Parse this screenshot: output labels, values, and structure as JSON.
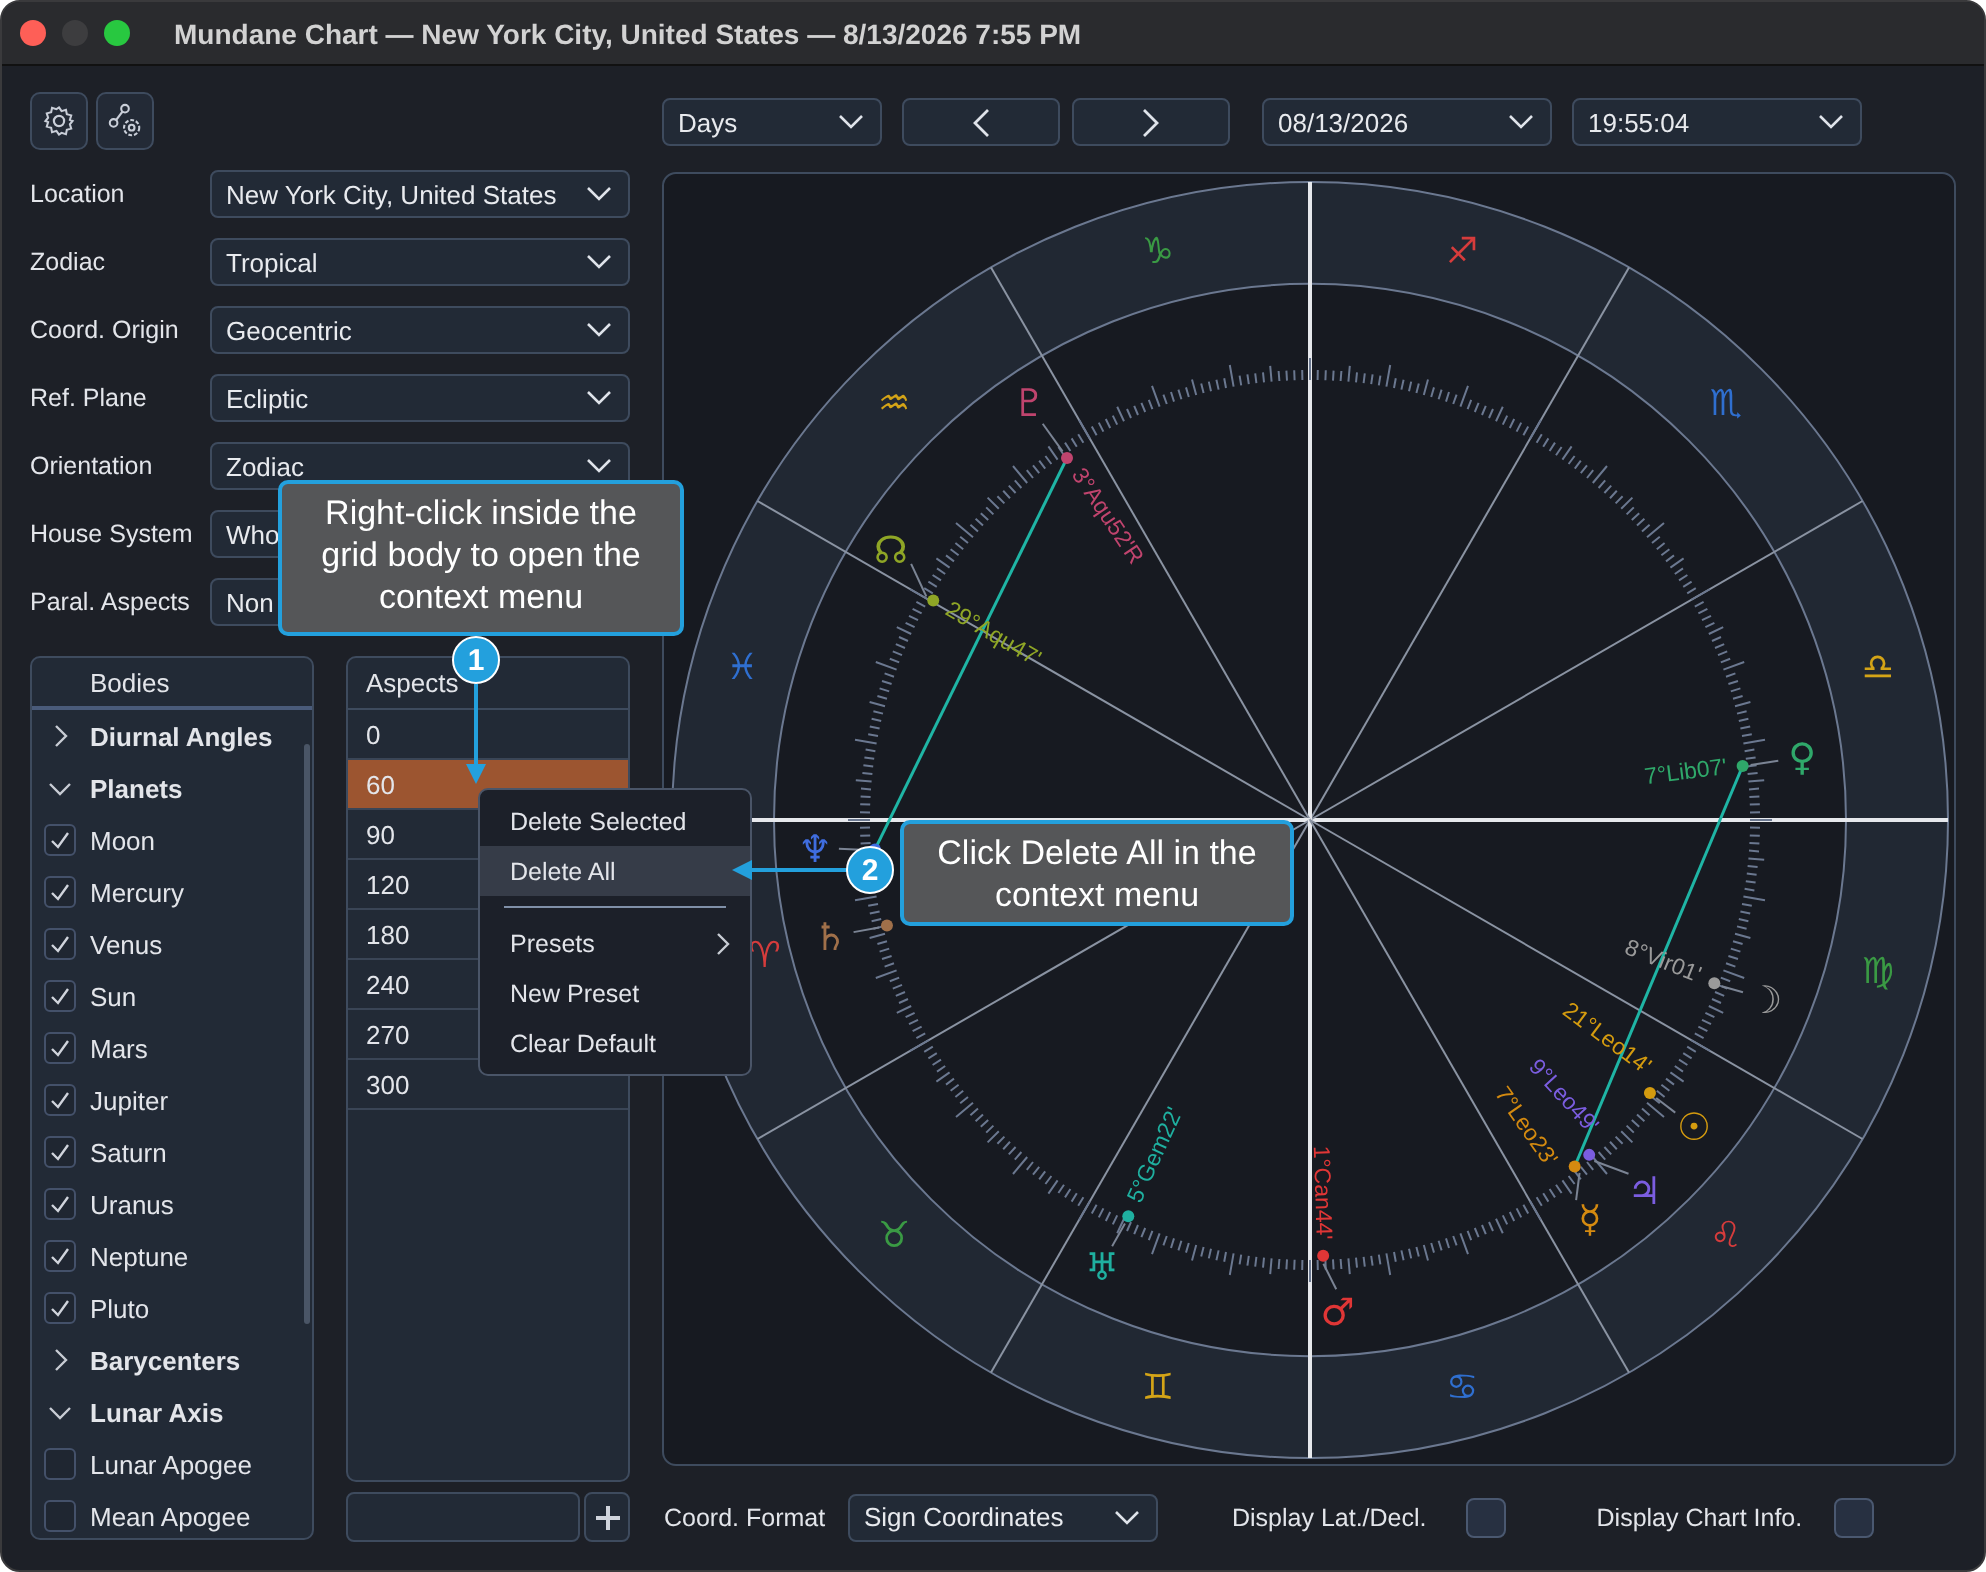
{
  "window": {
    "title": "Mundane Chart — New York City, United States — 8/13/2026 7:55 PM"
  },
  "settings": [
    {
      "label": "Location",
      "value": "New York City, United States"
    },
    {
      "label": "Zodiac",
      "value": "Tropical"
    },
    {
      "label": "Coord. Origin",
      "value": "Geocentric"
    },
    {
      "label": "Ref. Plane",
      "value": "Ecliptic"
    },
    {
      "label": "Orientation",
      "value": "Zodiac"
    },
    {
      "label": "House System",
      "value": "Who"
    },
    {
      "label": "Paral. Aspects",
      "value": "Non"
    }
  ],
  "bodies": {
    "header": "Bodies",
    "items": [
      {
        "label": "Diurnal Angles",
        "expanded": false
      },
      {
        "label": "Planets",
        "expanded": true,
        "children": [
          {
            "label": "Moon",
            "checked": true
          },
          {
            "label": "Mercury",
            "checked": true
          },
          {
            "label": "Venus",
            "checked": true
          },
          {
            "label": "Sun",
            "checked": true
          },
          {
            "label": "Mars",
            "checked": true
          },
          {
            "label": "Jupiter",
            "checked": true
          },
          {
            "label": "Saturn",
            "checked": true
          },
          {
            "label": "Uranus",
            "checked": true
          },
          {
            "label": "Neptune",
            "checked": true
          },
          {
            "label": "Pluto",
            "checked": true
          }
        ]
      },
      {
        "label": "Barycenters",
        "expanded": false
      },
      {
        "label": "Lunar Axis",
        "expanded": true,
        "children": [
          {
            "label": "Lunar Apogee",
            "checked": false
          },
          {
            "label": "Mean Apogee",
            "checked": false
          }
        ]
      }
    ]
  },
  "aspects": {
    "header": "Aspects",
    "rows": [
      {
        "value": "0",
        "selected": false
      },
      {
        "value": "60",
        "selected": true
      },
      {
        "value": "90",
        "selected": false
      },
      {
        "value": "120",
        "selected": false
      },
      {
        "value": "180",
        "selected": false
      },
      {
        "value": "240",
        "selected": false
      },
      {
        "value": "270",
        "selected": false
      },
      {
        "value": "300",
        "selected": false
      }
    ]
  },
  "context_menu": [
    {
      "kind": "item",
      "label": "Delete Selected",
      "highlighted": false
    },
    {
      "kind": "item",
      "label": "Delete All",
      "highlighted": true
    },
    {
      "kind": "separator"
    },
    {
      "kind": "submenu",
      "label": "Presets",
      "highlighted": false
    },
    {
      "kind": "item",
      "label": "New Preset",
      "highlighted": false
    },
    {
      "kind": "item",
      "label": "Clear Default",
      "highlighted": false
    }
  ],
  "time_controls": {
    "period": "Days",
    "date": "08/13/2026",
    "time": "19:55:04"
  },
  "chart": {
    "signs": [
      {
        "glyph": "♈",
        "color": "#d63c3c"
      },
      {
        "glyph": "♉",
        "color": "#3a9a44"
      },
      {
        "glyph": "♊",
        "color": "#d4a417"
      },
      {
        "glyph": "♋",
        "color": "#2f6fd0"
      },
      {
        "glyph": "♌",
        "color": "#d63c3c"
      },
      {
        "glyph": "♍",
        "color": "#3a9a44"
      },
      {
        "glyph": "♎",
        "color": "#d4a417"
      },
      {
        "glyph": "♏",
        "color": "#2f6fd0"
      },
      {
        "glyph": "♐",
        "color": "#d63c3c"
      },
      {
        "glyph": "♑",
        "color": "#3a9a44"
      },
      {
        "glyph": "♒",
        "color": "#d4a417"
      },
      {
        "glyph": "♓",
        "color": "#2f6fd0"
      }
    ],
    "planets": [
      {
        "glyph": "♇",
        "label": "3°Aqu52'R",
        "color": "#c0446e"
      },
      {
        "glyph": "☊",
        "label": "29°Aqu47'",
        "color": "#8fa626"
      },
      {
        "glyph": "♀",
        "label": "7°Lib07'",
        "color": "#2fa86a"
      },
      {
        "glyph": "☽",
        "label": "8°Vir01'",
        "color": "#9a9a9a"
      },
      {
        "glyph": "☉",
        "label": "21°Leo14'",
        "color": "#d49b0f"
      },
      {
        "glyph": "♃",
        "label": "9°Leo49'",
        "color": "#7b5de0"
      },
      {
        "glyph": "☿",
        "label": "7°Leo23'",
        "color": "#d48a10"
      },
      {
        "glyph": "♂",
        "label": "1°Can44'",
        "color": "#e03636"
      },
      {
        "glyph": "♅",
        "label": "5°Gem22'",
        "color": "#1fb0a0"
      },
      {
        "glyph": "♄",
        "color": "#a0704a"
      },
      {
        "glyph": "♆",
        "color": "#3f6de0"
      }
    ]
  },
  "coord_format": {
    "label": "Coord. Format",
    "value": "Sign Coordinates"
  },
  "options": [
    {
      "label": "Display Lat./Decl.",
      "checked": false
    },
    {
      "label": "Display Chart Info.",
      "checked": false
    }
  ],
  "callouts": [
    {
      "number": "1",
      "text": "Right-click inside the grid body to open the context menu"
    },
    {
      "number": "2",
      "text": "Click Delete All in the context menu"
    }
  ]
}
